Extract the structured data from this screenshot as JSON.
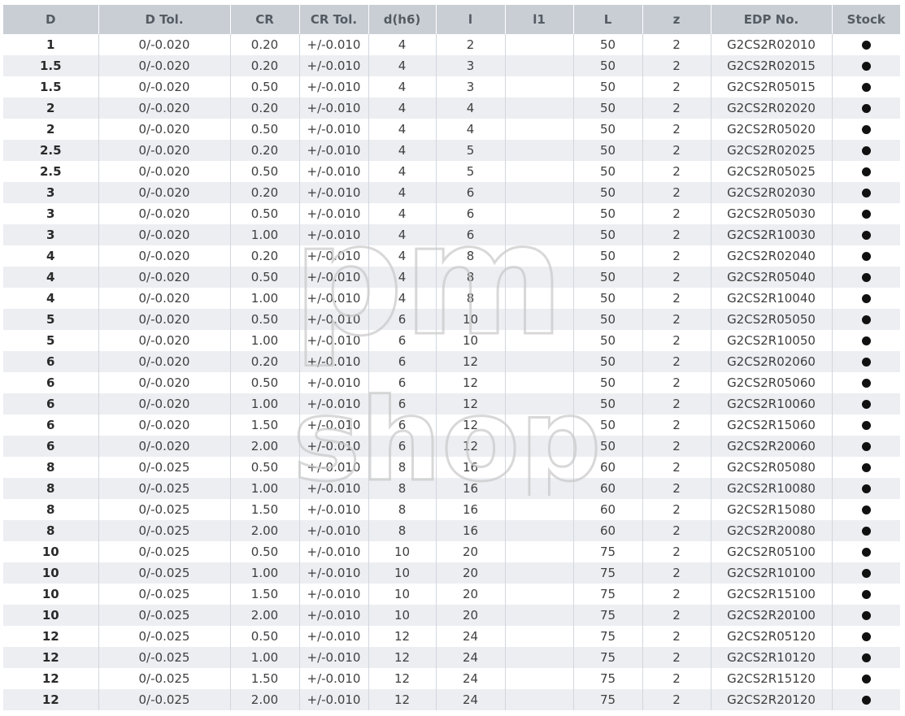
{
  "headers": [
    "D",
    "D Tol.",
    "CR",
    "CR Tol.",
    "d(h6)",
    "l",
    "l1",
    "L",
    "z",
    "EDP No.",
    "Stock"
  ],
  "rows": [
    [
      "1",
      "0/-0.020",
      "0.20",
      "+/-0.010",
      "4",
      "2",
      "",
      "50",
      "2",
      "G2CS2R02010",
      "●"
    ],
    [
      "1.5",
      "0/-0.020",
      "0.20",
      "+/-0.010",
      "4",
      "3",
      "",
      "50",
      "2",
      "G2CS2R02015",
      "●"
    ],
    [
      "1.5",
      "0/-0.020",
      "0.50",
      "+/-0.010",
      "4",
      "3",
      "",
      "50",
      "2",
      "G2CS2R05015",
      "●"
    ],
    [
      "2",
      "0/-0.020",
      "0.20",
      "+/-0.010",
      "4",
      "4",
      "",
      "50",
      "2",
      "G2CS2R02020",
      "●"
    ],
    [
      "2",
      "0/-0.020",
      "0.50",
      "+/-0.010",
      "4",
      "4",
      "",
      "50",
      "2",
      "G2CS2R05020",
      "●"
    ],
    [
      "2.5",
      "0/-0.020",
      "0.20",
      "+/-0.010",
      "4",
      "5",
      "",
      "50",
      "2",
      "G2CS2R02025",
      "●"
    ],
    [
      "2.5",
      "0/-0.020",
      "0.50",
      "+/-0.010",
      "4",
      "5",
      "",
      "50",
      "2",
      "G2CS2R05025",
      "●"
    ],
    [
      "3",
      "0/-0.020",
      "0.20",
      "+/-0.010",
      "4",
      "6",
      "",
      "50",
      "2",
      "G2CS2R02030",
      "●"
    ],
    [
      "3",
      "0/-0.020",
      "0.50",
      "+/-0.010",
      "4",
      "6",
      "",
      "50",
      "2",
      "G2CS2R05030",
      "●"
    ],
    [
      "3",
      "0/-0.020",
      "1.00",
      "+/-0.010",
      "4",
      "6",
      "",
      "50",
      "2",
      "G2CS2R10030",
      "●"
    ],
    [
      "4",
      "0/-0.020",
      "0.20",
      "+/-0.010",
      "4",
      "8",
      "",
      "50",
      "2",
      "G2CS2R02040",
      "●"
    ],
    [
      "4",
      "0/-0.020",
      "0.50",
      "+/-0.010",
      "4",
      "8",
      "",
      "50",
      "2",
      "G2CS2R05040",
      "●"
    ],
    [
      "4",
      "0/-0.020",
      "1.00",
      "+/-0.010",
      "4",
      "8",
      "",
      "50",
      "2",
      "G2CS2R10040",
      "●"
    ],
    [
      "5",
      "0/-0.020",
      "0.50",
      "+/-0.010",
      "6",
      "10",
      "",
      "50",
      "2",
      "G2CS2R05050",
      "●"
    ],
    [
      "5",
      "0/-0.020",
      "1.00",
      "+/-0.010",
      "6",
      "10",
      "",
      "50",
      "2",
      "G2CS2R10050",
      "●"
    ],
    [
      "6",
      "0/-0.020",
      "0.20",
      "+/-0.010",
      "6",
      "12",
      "",
      "50",
      "2",
      "G2CS2R02060",
      "●"
    ],
    [
      "6",
      "0/-0.020",
      "0.50",
      "+/-0.010",
      "6",
      "12",
      "",
      "50",
      "2",
      "G2CS2R05060",
      "●"
    ],
    [
      "6",
      "0/-0.020",
      "1.00",
      "+/-0.010",
      "6",
      "12",
      "",
      "50",
      "2",
      "G2CS2R10060",
      "●"
    ],
    [
      "6",
      "0/-0.020",
      "1.50",
      "+/-0.010",
      "6",
      "12",
      "",
      "50",
      "2",
      "G2CS2R15060",
      "●"
    ],
    [
      "6",
      "0/-0.020",
      "2.00",
      "+/-0.010",
      "6",
      "12",
      "",
      "50",
      "2",
      "G2CS2R20060",
      "●"
    ],
    [
      "8",
      "0/-0.025",
      "0.50",
      "+/-0.010",
      "8",
      "16",
      "",
      "60",
      "2",
      "G2CS2R05080",
      "●"
    ],
    [
      "8",
      "0/-0.025",
      "1.00",
      "+/-0.010",
      "8",
      "16",
      "",
      "60",
      "2",
      "G2CS2R10080",
      "●"
    ],
    [
      "8",
      "0/-0.025",
      "1.50",
      "+/-0.010",
      "8",
      "16",
      "",
      "60",
      "2",
      "G2CS2R15080",
      "●"
    ],
    [
      "8",
      "0/-0.025",
      "2.00",
      "+/-0.010",
      "8",
      "16",
      "",
      "60",
      "2",
      "G2CS2R20080",
      "●"
    ],
    [
      "10",
      "0/-0.025",
      "0.50",
      "+/-0.010",
      "10",
      "20",
      "",
      "75",
      "2",
      "G2CS2R05100",
      "●"
    ],
    [
      "10",
      "0/-0.025",
      "1.00",
      "+/-0.010",
      "10",
      "20",
      "",
      "75",
      "2",
      "G2CS2R10100",
      "●"
    ],
    [
      "10",
      "0/-0.025",
      "1.50",
      "+/-0.010",
      "10",
      "20",
      "",
      "75",
      "2",
      "G2CS2R15100",
      "●"
    ],
    [
      "10",
      "0/-0.025",
      "2.00",
      "+/-0.010",
      "10",
      "20",
      "",
      "75",
      "2",
      "G2CS2R20100",
      "●"
    ],
    [
      "12",
      "0/-0.025",
      "0.50",
      "+/-0.010",
      "12",
      "24",
      "",
      "75",
      "2",
      "G2CS2R05120",
      "●"
    ],
    [
      "12",
      "0/-0.025",
      "1.00",
      "+/-0.010",
      "12",
      "24",
      "",
      "75",
      "2",
      "G2CS2R10120",
      "●"
    ],
    [
      "12",
      "0/-0.025",
      "1.50",
      "+/-0.010",
      "12",
      "24",
      "",
      "75",
      "2",
      "G2CS2R15120",
      "●"
    ],
    [
      "12",
      "0/-0.025",
      "2.00",
      "+/-0.010",
      "12",
      "24",
      "",
      "75",
      "2",
      "G2CS2R20120",
      "●"
    ]
  ],
  "watermark": {
    "line1": "pm",
    "line2": "shop"
  },
  "colors": {
    "header_bg": "#c9ced5",
    "stripe_bg": "#eceef2",
    "text": "#404040"
  }
}
